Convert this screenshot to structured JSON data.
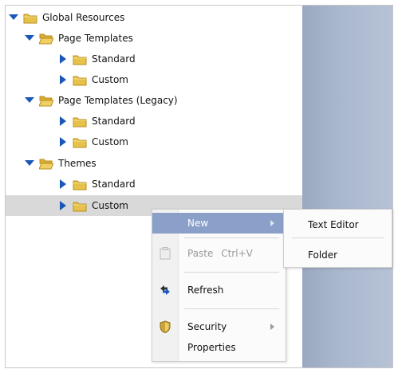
{
  "tree": {
    "nodes": [
      {
        "label": "Global Resources",
        "expanded": true,
        "depth": 0
      },
      {
        "label": "Page Templates",
        "expanded": true,
        "depth": 1
      },
      {
        "label": "Standard",
        "expanded": false,
        "depth": 2
      },
      {
        "label": "Custom",
        "expanded": false,
        "depth": 2
      },
      {
        "label": "Page Templates (Legacy)",
        "expanded": true,
        "depth": 1
      },
      {
        "label": "Standard",
        "expanded": false,
        "depth": 2
      },
      {
        "label": "Custom",
        "expanded": false,
        "depth": 2
      },
      {
        "label": "Themes",
        "expanded": true,
        "depth": 1
      },
      {
        "label": "Standard",
        "expanded": false,
        "depth": 2
      },
      {
        "label": "Custom",
        "expanded": false,
        "depth": 2,
        "hovered": true
      }
    ]
  },
  "context_menu": {
    "new_label": "New",
    "paste_label": "Paste",
    "paste_shortcut": "Ctrl+V",
    "refresh_label": "Refresh",
    "security_label": "Security",
    "properties_label": "Properties"
  },
  "submenu": {
    "text_editor_label": "Text Editor",
    "folder_label": "Folder"
  },
  "colors": {
    "toggle_blue": "#1b57b7",
    "folder_yellow": "#e7c24a",
    "menu_active": "#8aa0c9",
    "splitter": "#5a7ec6"
  },
  "icons": {
    "expanded": "triangle-down-icon",
    "collapsed": "triangle-right-icon",
    "folder": "folder-icon",
    "folder_open": "folder-open-icon",
    "paste": "paste-icon",
    "refresh": "refresh-icon",
    "security": "shield-icon",
    "submenu": "chevron-right-icon"
  }
}
